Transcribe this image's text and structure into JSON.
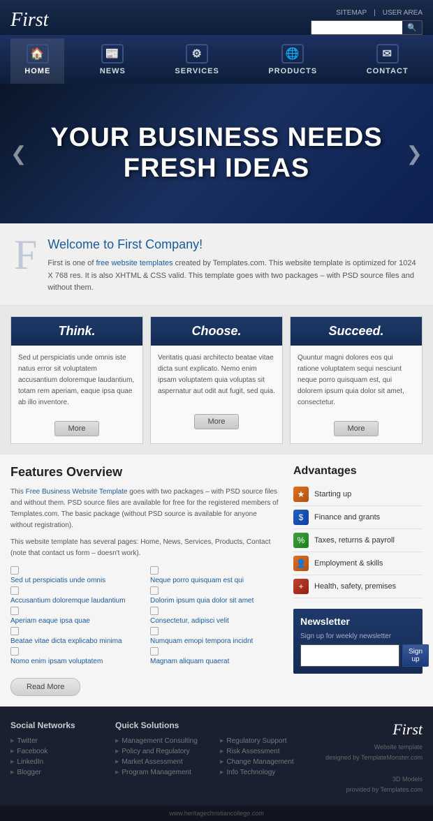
{
  "header": {
    "logo": "First",
    "links": [
      "SITEMAP",
      "USER AREA"
    ],
    "search_placeholder": ""
  },
  "nav": {
    "items": [
      {
        "id": "home",
        "label": "HOME",
        "icon": "🏠"
      },
      {
        "id": "news",
        "label": "NEWS",
        "icon": "📰"
      },
      {
        "id": "services",
        "label": "SERVICES",
        "icon": "⚙"
      },
      {
        "id": "products",
        "label": "PRODUCTS",
        "icon": "🌐"
      },
      {
        "id": "contact",
        "label": "CONTACT",
        "icon": "✉"
      }
    ]
  },
  "hero": {
    "line1": "YOUR BUSINESS NEEDS",
    "line2": "FRESH IDEAS"
  },
  "welcome": {
    "title_plain": "Welcome to ",
    "title_colored": "First Company",
    "title_end": "!",
    "body": "First is one of free website templates created by Templates.com. This website template is optimized for 1024 X 768 res. It is also XHTML & CSS valid. This template goes with two packages – with PSD source files and without them.",
    "link_text": "free website templates"
  },
  "boxes": [
    {
      "title": "Think.",
      "body": "Sed ut perspiciatis unde omnis iste natus error sit voluptatem accusantium doloremque laudantium, totam rem aperiam, eaque ipsa quae ab illo inventore.",
      "button": "More"
    },
    {
      "title": "Choose.",
      "body": "Veritatis quasi architecto beatae vitae dicta sunt explicato. Nemo enim ipsam voluptatem quia voluptas sit aspernatur aut odit aut fugit, sed quia.",
      "button": "More"
    },
    {
      "title": "Succeed.",
      "body": "Quuntur magni dolores eos qui ratione voluptatem sequi nesciunt neque porro quisquam est, qui dolorem ipsum quia dolor sit amet, consectetur.",
      "button": "More"
    }
  ],
  "features": {
    "title": "Features Overview",
    "para1": "This Free Business Website Template goes with two packages – with PSD source files and without them. PSD source files are available for free for the registered members of Templates.com. The basic package (without PSD source is available for anyone without registration).",
    "para2": "This website template has several pages: Home, News, Services, Products, Contact (note that contact us form – doesn't work).",
    "link1_text": "Free Business Website Template",
    "list": [
      "Sed ut perspiciatis unde omnis",
      "Neque porro quisquam est qui",
      "Accusantium doloremque laudantium",
      "Dolorim ipsum quia dolor sit amet",
      "Aperiam eaque ipsa quae",
      "Consectetur, adipisci velit",
      "Beatae vitae dicta explicabo minima",
      "Numquam emopi tempora incidnt",
      "Nomo enim ipsam voluptatem",
      "Magnam aliquam quaerat"
    ],
    "read_more": "Read More"
  },
  "advantages": {
    "title": "Advantages",
    "items": [
      {
        "icon": "★",
        "color": "orange",
        "label": "Starting up"
      },
      {
        "icon": "💰",
        "color": "blue",
        "label": "Finance and grants"
      },
      {
        "icon": "📋",
        "color": "green",
        "label": "Taxes, returns & payroll"
      },
      {
        "icon": "👤",
        "color": "orange",
        "label": "Employment & skills"
      },
      {
        "icon": "🏠",
        "color": "red",
        "label": "Health, safety, premises"
      }
    ]
  },
  "newsletter": {
    "title": "Newsletter",
    "body": "Sign up for weekly newsletter",
    "placeholder": "",
    "button": "Sign up"
  },
  "footer": {
    "social": {
      "title": "Social Networks",
      "items": [
        "Twitter",
        "Facebook",
        "LinkedIn",
        "Blogger"
      ]
    },
    "quick": {
      "title": "Quick Solutions",
      "items": [
        "Management Consulting",
        "Policy and Regulatory",
        "Market Assessment",
        "Program Management"
      ]
    },
    "col3": {
      "items": [
        "Regulatory Support",
        "Risk Assessment",
        "Change Management",
        "Info Technology"
      ]
    },
    "logo": "First",
    "tagline": "Website template",
    "designed_by": "designed by TemplateMonster.com",
    "models_label": "3D Models",
    "provided_by": "provided by Templates.com"
  },
  "footer_bottom": {
    "url": "www.heritagechristiancollege.com"
  }
}
